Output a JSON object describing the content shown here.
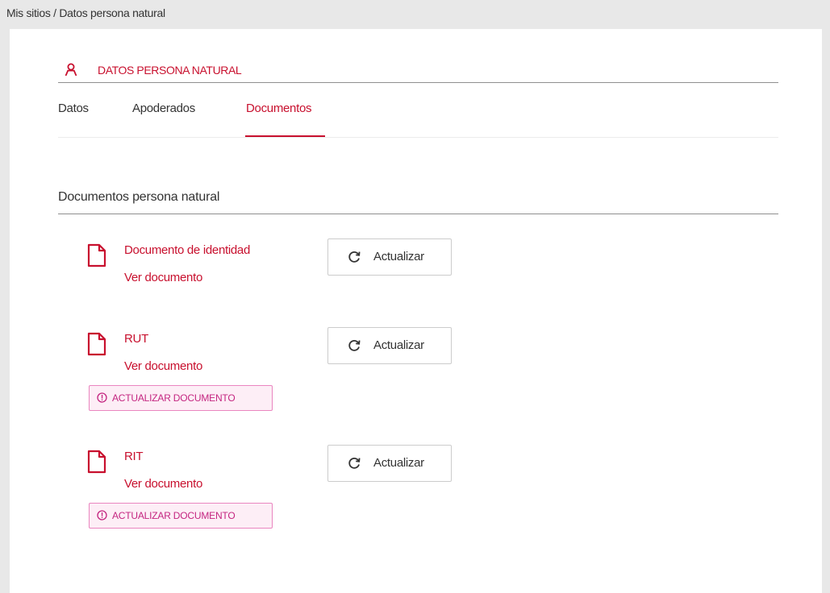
{
  "breadcrumb": "Mis sitios / Datos persona natural",
  "header": {
    "icon": "user-icon",
    "title": "DATOS PERSONA NATURAL"
  },
  "tabs": [
    {
      "label": "Datos",
      "active": false
    },
    {
      "label": "Apoderados",
      "active": false
    },
    {
      "label": "Documentos",
      "active": true
    }
  ],
  "section": {
    "title": "Documentos persona natural"
  },
  "documents": [
    {
      "name": "Documento de identidad",
      "link": "Ver documento",
      "button_label": "Actualizar",
      "warning": null
    },
    {
      "name": "RUT",
      "link": "Ver documento",
      "button_label": "Actualizar",
      "warning": "ACTUALIZAR DOCUMENTO"
    },
    {
      "name": "RIT",
      "link": "Ver documento",
      "button_label": "Actualizar",
      "warning": "ACTUALIZAR DOCUMENTO"
    }
  ],
  "colors": {
    "accent": "#c8102e",
    "warning_border": "#ea86c0",
    "warning_bg": "#fdeef6",
    "warning_text": "#c42580",
    "page_bg": "#e8e8e8"
  }
}
